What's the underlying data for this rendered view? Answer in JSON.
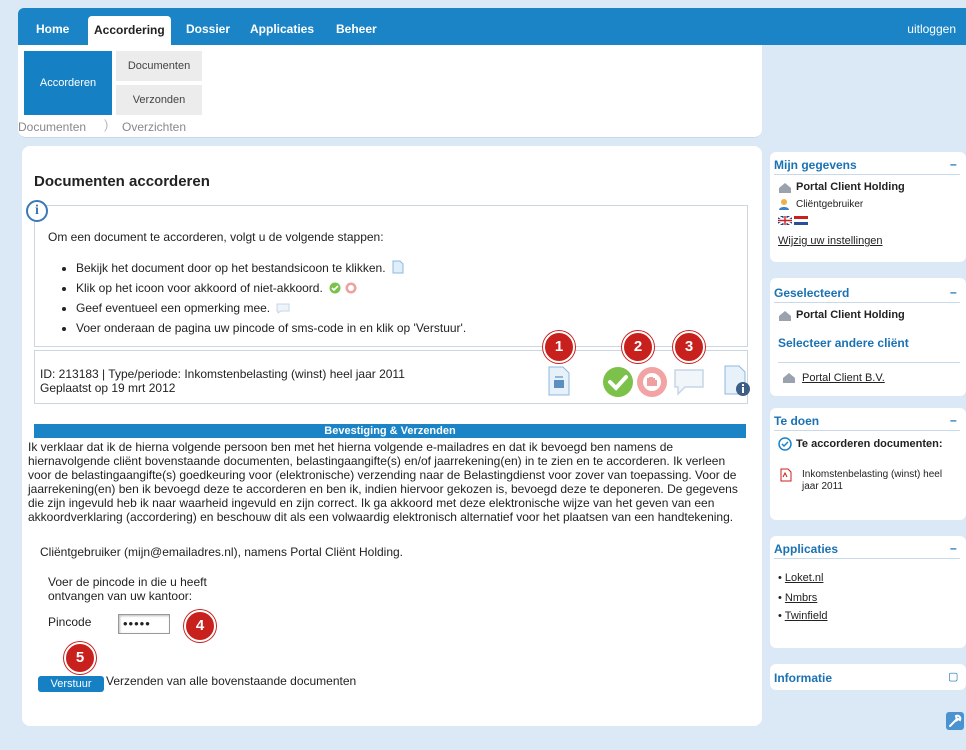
{
  "nav": {
    "tabs": [
      "Home",
      "Accordering",
      "Dossier",
      "Applicaties",
      "Beheer"
    ],
    "logout": "uitloggen"
  },
  "subnav": {
    "primary": "Accorderen",
    "items": [
      "Documenten",
      "Verzonden"
    ],
    "section_left": "Documenten",
    "section_right": "Overzichten"
  },
  "main": {
    "title": "Documenten accorderen",
    "intro": "Om een document te accorderen, volgt u de volgende stappen:",
    "steps": [
      "Bekijk het document door op het bestandsicoon te klikken.",
      "Klik op het icoon voor akkoord of niet-akkoord.",
      "Geef eventueel een opmerking mee.",
      "Voer onderaan de pagina uw pincode of sms-code in en klik op 'Verstuur'."
    ],
    "doc_line1": "ID: 213183 | Type/periode: Inkomstenbelasting (winst) heel jaar 2011",
    "doc_line2": "Geplaatst op 19 mrt 2012",
    "badges": [
      "1",
      "2",
      "3",
      "4",
      "5"
    ],
    "confirm_header": "Bevestiging & Verzenden",
    "confirm_text": "Ik verklaar dat ik de hierna volgende persoon ben met het hierna volgende e-mailadres en dat ik bevoegd ben namens de hiernavolgende cliënt bovenstaande documenten, belastingaangifte(s) en/of jaarrekening(en) in te zien en te accorderen. Ik verleen voor de belastingaangifte(s) goedkeuring voor (elektronische) verzending naar de Belastingdienst voor zover van toepassing. Voor de jaarrekening(en) ben ik bevoegd deze te accorderen en ben ik, indien hiervoor gekozen is, bevoegd deze te deponeren. De gegevens die zijn ingevuld heb ik naar waarheid ingevuld en zijn correct. Ik ga akkoord met deze elektronische wijze van het geven van een akkoordverklaring (accordering) en beschouw dit als een volwaardig elektronisch alternatief voor het plaatsen van een handtekening.",
    "user_line": "Cliëntgebruiker (mijn@emailadres.nl), namens Portal Cliënt Holding.",
    "pin_instruction_1": "Voer de pincode in die u heeft",
    "pin_instruction_2": "ontvangen van uw kantoor:",
    "pin_label": "Pincode",
    "pin_value": "•••••",
    "send_button": "Verstuur",
    "send_text": "Verzenden van alle bovenstaande documenten"
  },
  "sidebar": {
    "mijn": {
      "title": "Mijn gegevens",
      "toggle": "–",
      "company": "Portal Client Holding",
      "role": "Cliëntgebruiker",
      "settings_link": "Wijzig uw instellingen"
    },
    "geselecteerd": {
      "title": "Geselecteerd",
      "toggle": "–",
      "company": "Portal Client Holding",
      "select_link": "Selecteer andere cliënt",
      "other_client": "Portal Client B.V."
    },
    "todo": {
      "title": "Te doen",
      "toggle": "–",
      "heading": "Te accorderen documenten:",
      "item": "Inkomstenbelasting (winst) heel jaar 2011"
    },
    "applicaties": {
      "title": "Applicaties",
      "toggle": "–",
      "items": [
        "Loket.nl",
        "Nmbrs",
        "Twinfield"
      ]
    },
    "informatie": {
      "title": "Informatie",
      "toggle": "▢"
    }
  },
  "colors": {
    "brand_blue": "#1a84c7",
    "badge_red": "#c8201c",
    "approve_green": "#7cc14a",
    "reject_red": "#e88080"
  }
}
